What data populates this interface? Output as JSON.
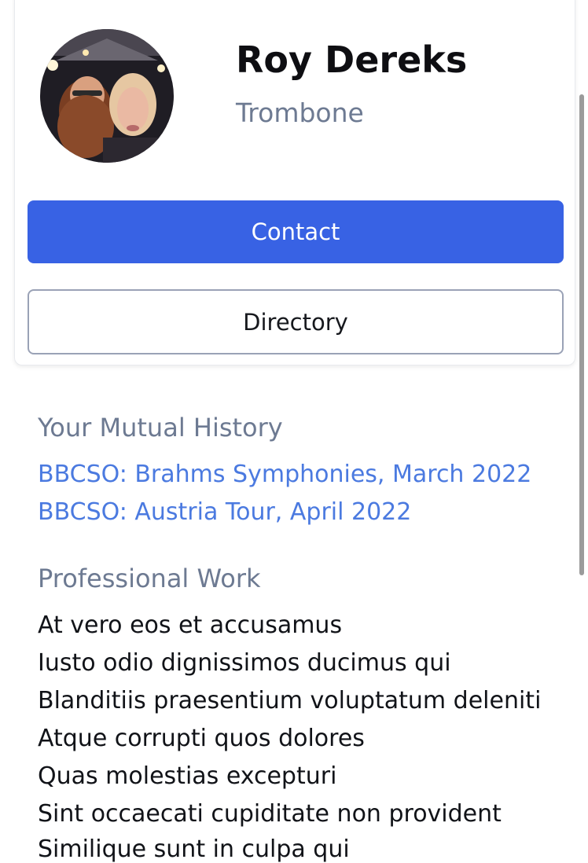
{
  "profile": {
    "name": "Roy Dereks",
    "role": "Trombone"
  },
  "actions": {
    "contact_label": "Contact",
    "directory_label": "Directory"
  },
  "mutual_history": {
    "title": "Your Mutual History",
    "items": [
      "BBCSO: Brahms Symphonies, March 2022",
      "BBCSO: Austria Tour, April 2022"
    ]
  },
  "professional_work": {
    "title": "Professional Work",
    "items": [
      "At vero eos et accusamus",
      "Iusto odio dignissimos ducimus qui",
      "Blanditiis praesentium voluptatum deleniti",
      "Atque corrupti quos dolores",
      "Quas molestias excepturi",
      "Sint occaecati cupiditate non provident",
      "Similique sunt in culpa qui"
    ]
  },
  "colors": {
    "primary": "#3862e4",
    "link": "#4b7ae0",
    "muted": "#6d7a92"
  }
}
